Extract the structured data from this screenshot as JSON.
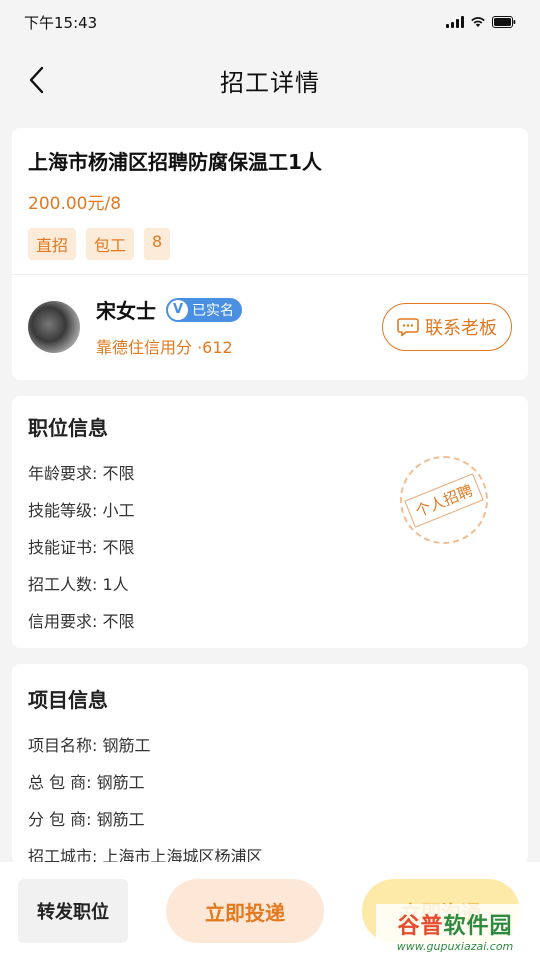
{
  "status_bar": {
    "time": "下午15:43"
  },
  "nav": {
    "title": "招工详情"
  },
  "job": {
    "title": "上海市杨浦区招聘防腐保温工1人",
    "salary": "200.00元/8",
    "tags": [
      "直招",
      "包工",
      "8"
    ]
  },
  "boss": {
    "name": "宋女士",
    "verified_label": "已实名",
    "verified_icon_text": "V",
    "credit": "靠德住信用分 ·612",
    "contact_label": "联系老板"
  },
  "position": {
    "section_title": "职位信息",
    "stamp": "个人招聘",
    "rows": [
      {
        "label": "年龄要求:",
        "value": "不限"
      },
      {
        "label": "技能等级:",
        "value": "小工"
      },
      {
        "label": "技能证书:",
        "value": "不限"
      },
      {
        "label": "招工人数:",
        "value": "1人"
      },
      {
        "label": "信用要求:",
        "value": "不限"
      }
    ]
  },
  "project": {
    "section_title": "项目信息",
    "rows": [
      {
        "label": "项目名称:",
        "value": "钢筋工"
      },
      {
        "label": "总 包 商:",
        "value": "钢筋工"
      },
      {
        "label": "分 包 商:",
        "value": "钢筋工"
      },
      {
        "label": "招工城市:",
        "value": "上海市上海城区杨浦区"
      }
    ]
  },
  "bottom": {
    "share_label": "转发职位",
    "apply_label": "立即投递",
    "chat_label": "立即沟通"
  },
  "watermark": {
    "brand_a": "谷普",
    "brand_b": "软件园",
    "url": "www.gupuxiazai.com"
  },
  "colors": {
    "accent": "#e2791f",
    "verified": "#4a90e2",
    "chat_bg": "#fde9a8"
  }
}
